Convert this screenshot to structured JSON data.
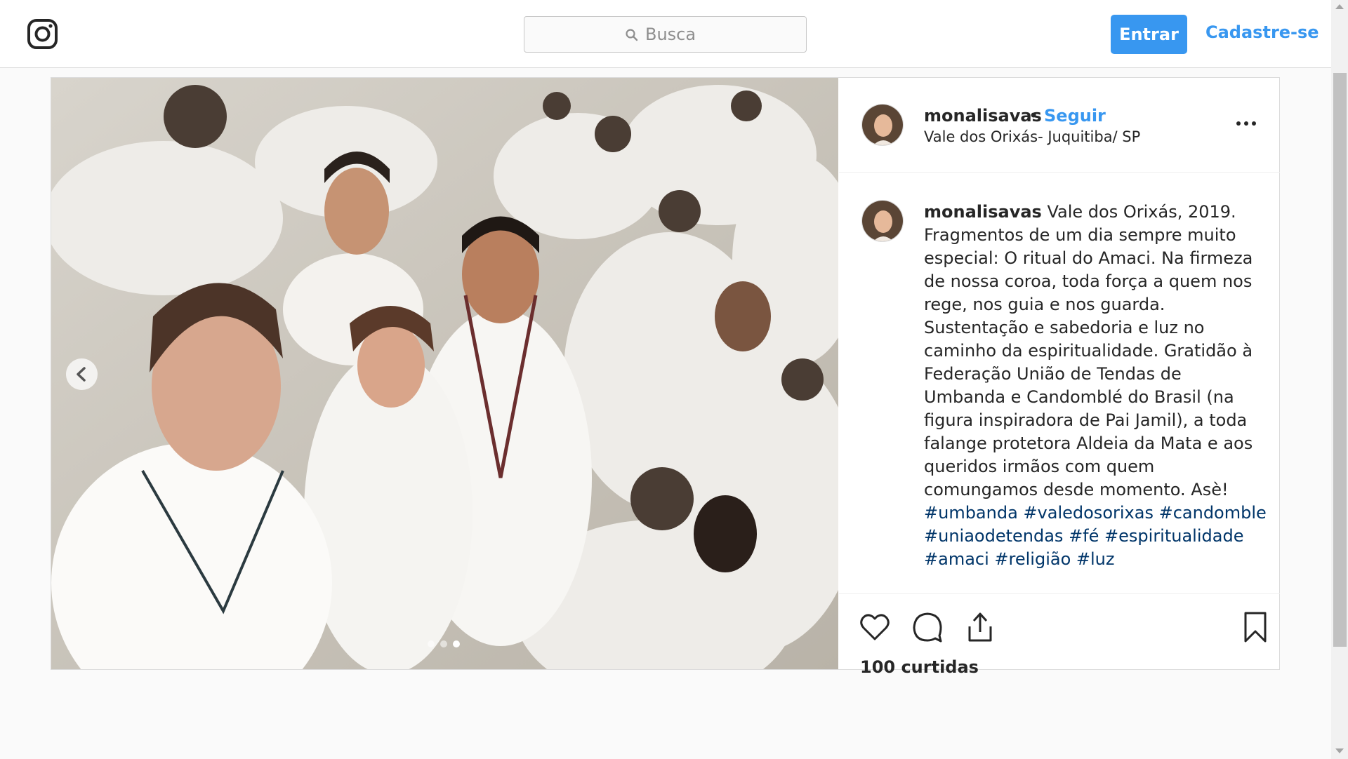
{
  "header": {
    "search_placeholder": "Busca",
    "login_label": "Entrar",
    "signup_label": "Cadastre-se"
  },
  "post": {
    "username": "monalisavas",
    "separator": "•",
    "follow_label": "Seguir",
    "location": "Vale dos Orixás- Juquitiba/ SP",
    "carousel": {
      "slide_count": 3,
      "active_slide": 3
    },
    "caption": {
      "username": "monalisavas",
      "text": "Vale dos Orixás, 2019. Fragmentos de um dia sempre muito especial: O ritual do Amaci. Na firmeza de nossa coroa, toda força a quem nos rege, nos guia e nos guarda. Sustentação e sabedoria e luz no caminho da espiritualidade. Gratidão à Federação União de Tendas de Umbanda e Candomblé do Brasil (na figura inspiradora de Pai Jamil), a toda falange protetora Aldeia da Mata e aos queridos irmãos com quem comungamos desde momento. Asè!",
      "hashtags": [
        "#umbanda",
        "#valedosorixas",
        "#candomble",
        "#uniaodetendas",
        "#fé",
        "#espiritualidade",
        "#amaci",
        "#religião",
        "#luz"
      ]
    },
    "likes": "100 curtidas"
  },
  "colors": {
    "accent": "#3897f0",
    "hashtag": "#003569",
    "border": "#dbdbdb",
    "text": "#262626"
  },
  "icons": [
    "instagram-logo-icon",
    "search-icon",
    "chevron-left-icon",
    "more-icon",
    "heart-icon",
    "comment-icon",
    "share-icon",
    "bookmark-icon"
  ]
}
